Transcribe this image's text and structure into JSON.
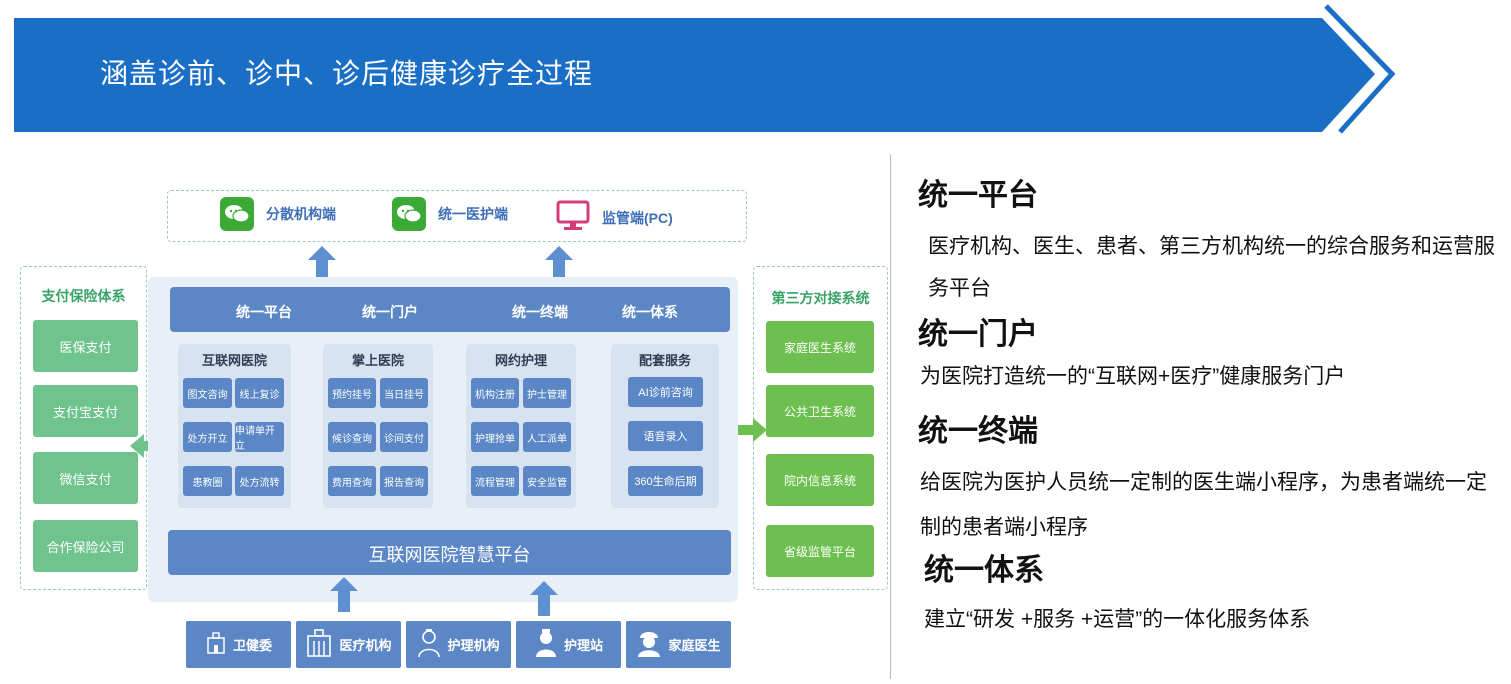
{
  "banner": {
    "title": "涵盖诊前、诊中、诊后健康诊疗全过程",
    "color": "#1a6ec6"
  },
  "diagram": {
    "top_channels": [
      {
        "label": "分散机构端",
        "icon": "wechat-icon"
      },
      {
        "label": "统一医护端",
        "icon": "wechat-icon"
      },
      {
        "label": "监管端(PC)",
        "icon": "monitor-icon"
      }
    ],
    "left_panel": {
      "title": "支付保险体系",
      "items": [
        "医保支付",
        "支付宝支付",
        "微信支付",
        "合作保险公司"
      ]
    },
    "right_panel": {
      "title": "第三方对接系统",
      "items": [
        "家庭医生系统",
        "公共卫生系统",
        "院内信息系统",
        "省级监管平台"
      ]
    },
    "header_bar": [
      "统一平台",
      "统一门户",
      "统一终端",
      "统一体系"
    ],
    "modules": [
      {
        "title": "互联网医院",
        "items": [
          "图文咨询",
          "线上复诊",
          "处方开立",
          "申请单开立",
          "患教圈",
          "处方流转"
        ]
      },
      {
        "title": "掌上医院",
        "items": [
          "预约挂号",
          "当日挂号",
          "候诊查询",
          "诊间支付",
          "费用查询",
          "报告查询"
        ]
      },
      {
        "title": "网约护理",
        "items": [
          "机构注册",
          "护士管理",
          "护理抢单",
          "人工派单",
          "流程管理",
          "安全监管"
        ]
      },
      {
        "title": "配套服务",
        "items": [
          "AI诊前咨询",
          "语音录入",
          "360生命后期"
        ]
      }
    ],
    "platform_label": "互联网医院智慧平台",
    "bottom_sources": [
      {
        "label": "卫健委",
        "icon": "government-icon"
      },
      {
        "label": "医疗机构",
        "icon": "hospital-icon"
      },
      {
        "label": "护理机构",
        "icon": "nurse-icon"
      },
      {
        "label": "护理站",
        "icon": "nurse-station-icon"
      },
      {
        "label": "家庭医生",
        "icon": "doctor-icon"
      }
    ],
    "colors": {
      "blue": "#5b87c6",
      "green": "#6fc38c",
      "accent_green": "#3aa368"
    }
  },
  "descriptions": [
    {
      "heading": "统一平台",
      "text": "医疗机构、医生、患者、第三方机构统一的综合服务和运营服务平台"
    },
    {
      "heading": "统一门户",
      "text": "为医院打造统一的“互联网+医疗”健康服务门户"
    },
    {
      "heading": "统一终端",
      "text": "给医院为医护人员统一定制的医生端小程序，为患者端统一定制的患者端小程序"
    },
    {
      "heading": "统一体系",
      "text": "建立“研发 +服务 +运营”的一体化服务体系"
    }
  ]
}
